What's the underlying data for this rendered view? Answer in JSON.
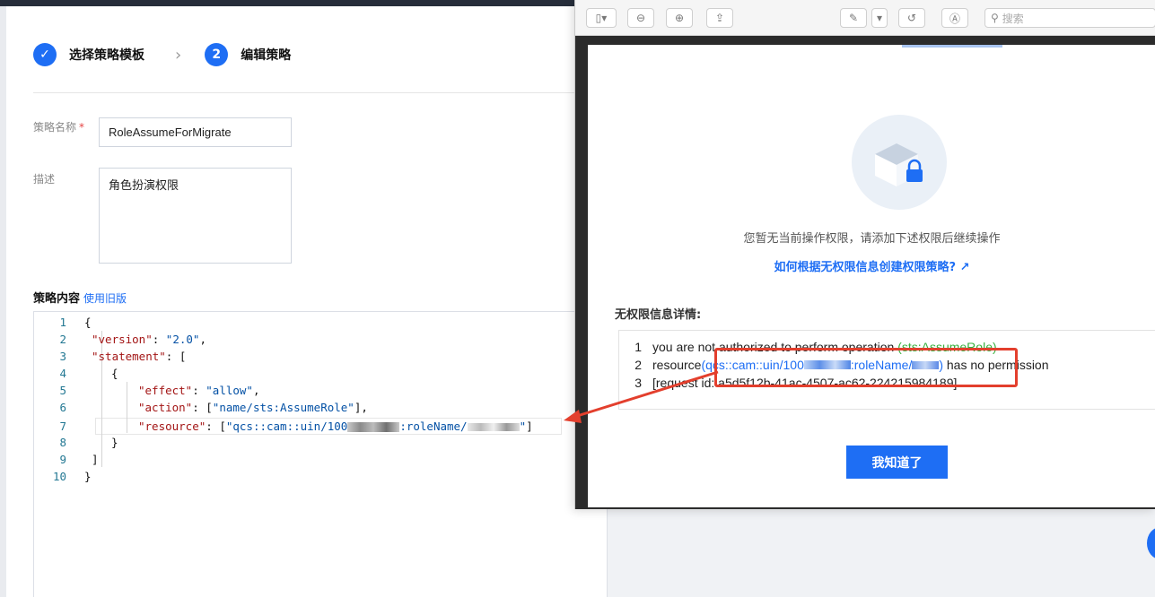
{
  "steps": [
    {
      "marker": "✓",
      "label": "选择策略模板"
    },
    {
      "marker": "2",
      "label": "编辑策略"
    }
  ],
  "form": {
    "name_label": "策略名称",
    "required_mark": "*",
    "name_value": "RoleAssumeForMigrate",
    "desc_label": "描述",
    "desc_value": "角色扮演权限"
  },
  "policy": {
    "title": "策略内容",
    "old_version_link": "使用旧版"
  },
  "editor": {
    "line_numbers": [
      "1",
      "2",
      "3",
      "4",
      "5",
      "6",
      "7",
      "8",
      "9",
      "10"
    ],
    "l1": "{",
    "l2_key": "\"version\"",
    "l2_val": "\"2.0\"",
    "l3_key": "\"statement\"",
    "l3_rest": ": [",
    "l4": "{",
    "l5_key": "\"effect\"",
    "l5_val": "\"allow\"",
    "l6_key": "\"action\"",
    "l6_val": "\"name/sts:AssumeRole\"",
    "l7_key": "\"resource\"",
    "l7_val_a": "\"qcs::cam::uin/100",
    "l7_val_b": ":roleName/",
    "l7_val_c": "\"",
    "l8": "}",
    "l9": "]",
    "l10": "}"
  },
  "preview": {
    "search_placeholder": "搜索",
    "no_permission_hint": "您暂无当前操作权限，请添加下述权限后继续操作",
    "help_link": "如何根据无权限信息创建权限策略?",
    "details_title": "无权限信息详情:",
    "err1_prefix": "you are not authorized to perform operation ",
    "err1_action": "(sts:AssumeRole)",
    "err2_prefix": "resource",
    "err2_res_a": "(qcs::cam::uin/100",
    "err2_res_b": ":roleName/",
    "err2_res_c": ")",
    "err2_suffix": " has no permission",
    "err3": "[request id: a5d5f12b-41ac-4507-ac62-224215984189]",
    "ok_button": "我知道了"
  },
  "colors": {
    "accent": "#1e6ef4",
    "annotation_red": "#e33f2d",
    "action_green": "#38b03f"
  }
}
